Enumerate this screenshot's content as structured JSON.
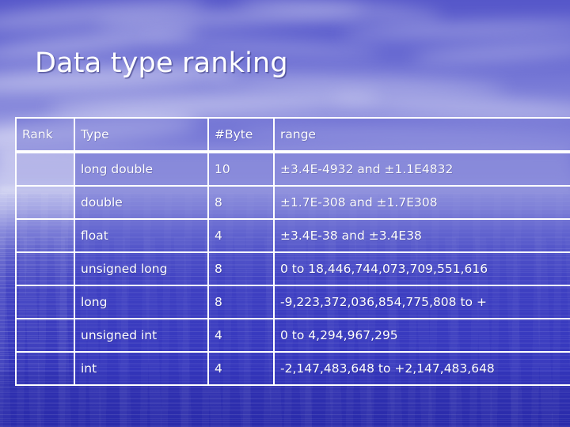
{
  "slide": {
    "title": "Data type ranking",
    "background": {
      "theme": "blue-sky-over-water",
      "sky_color": "#6163cf",
      "water_color": "#3334b8",
      "cloud_color": "#ffffff"
    },
    "text_color": "#ffffff",
    "table_border_color": "#ffffff"
  },
  "table": {
    "columns": [
      "Rank",
      "Type",
      "#Byte",
      "range"
    ],
    "rows": [
      {
        "rank": "",
        "type": "long double",
        "bytes": "10",
        "range": "±3.4E-4932 and ±1.1E4832"
      },
      {
        "rank": "",
        "type": "double",
        "bytes": "8",
        "range": "±1.7E-308 and ±1.7E308"
      },
      {
        "rank": "",
        "type": "float",
        "bytes": "4",
        "range": "±3.4E-38 and ±3.4E38"
      },
      {
        "rank": "",
        "type": "unsigned long",
        "bytes": "8",
        "range": "0 to 18,446,744,073,709,551,616"
      },
      {
        "rank": "",
        "type": "long",
        "bytes": "8",
        "range": "-9,223,372,036,854,775,808 to +"
      },
      {
        "rank": "",
        "type": "unsigned int",
        "bytes": "4",
        "range": "0 to 4,294,967,295"
      },
      {
        "rank": "",
        "type": "int",
        "bytes": "4",
        "range": "-2,147,483,648 to +2,147,483,648"
      }
    ]
  }
}
